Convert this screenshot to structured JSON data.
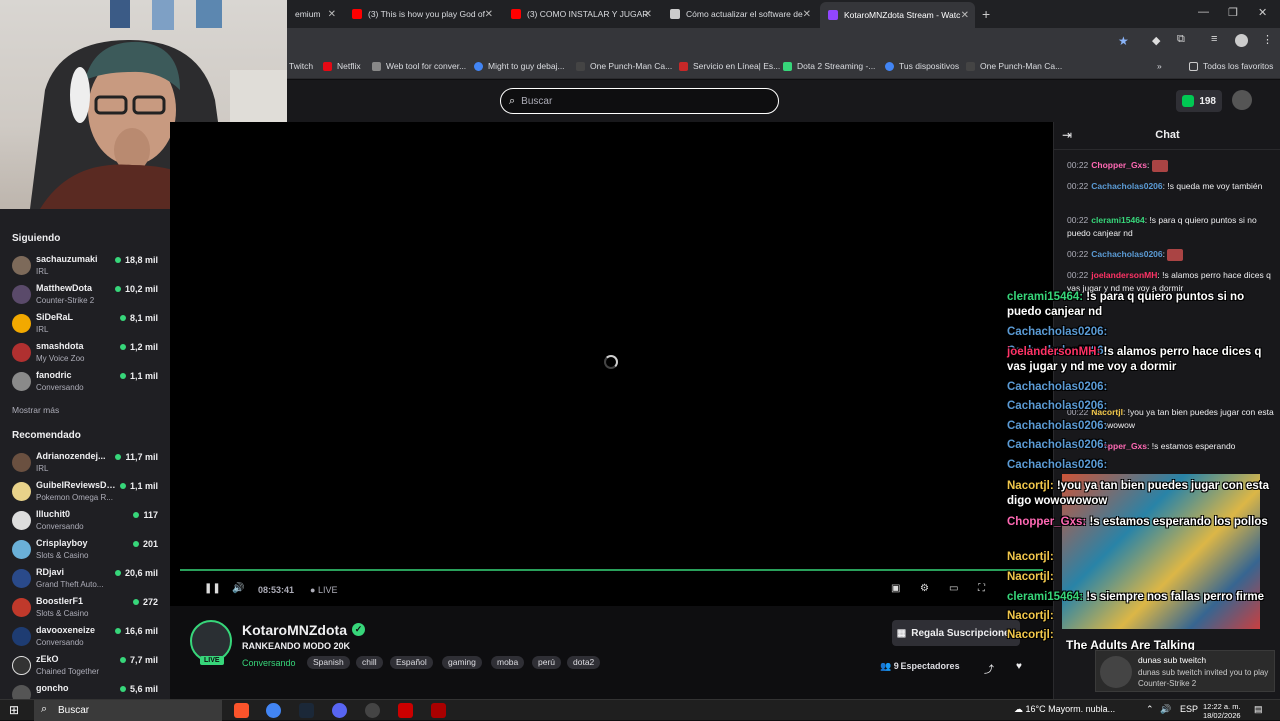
{
  "browser": {
    "tabs": [
      {
        "title": "emium",
        "color": "#ffffff"
      },
      {
        "title": "(3) This is how you play God of",
        "color": "#ff0000"
      },
      {
        "title": "(3) COMO INSTALAR Y JUGAR",
        "color": "#ff0000"
      },
      {
        "title": "Cómo actualizar el software de",
        "color": "#cccccc"
      },
      {
        "title": "KotaroMNZdota Stream - Watc",
        "color": "#9146ff"
      }
    ],
    "bookmarks": [
      "Twitch",
      "Netflix",
      "Web tool for conver...",
      "Might to guy debaj...",
      "One Punch-Man Ca...",
      "Servicio en Línea| Es...",
      "Dota 2 Streaming -...",
      "Tus dispositivos",
      "One Punch-Man Ca..."
    ],
    "all_favorites": "Todos los favoritos"
  },
  "topnav": {
    "search_placeholder": "Buscar",
    "points": "198"
  },
  "sidebar": {
    "following_title": "Siguiendo",
    "following": [
      {
        "name": "sachauzumaki",
        "game": "IRL",
        "viewers": "18,8 mil"
      },
      {
        "name": "MatthewDota",
        "game": "Counter-Strike 2",
        "viewers": "10,2 mil"
      },
      {
        "name": "SiDeRaL",
        "game": "IRL",
        "viewers": "8,1 mil"
      },
      {
        "name": "smashdota",
        "game": "My Voice Zoo",
        "viewers": "1,2 mil"
      },
      {
        "name": "fanodric",
        "game": "Conversando",
        "viewers": "1,1 mil"
      }
    ],
    "show_more": "Mostrar más",
    "recommended_title": "Recomendado",
    "recommended": [
      {
        "name": "Adrianozendej...",
        "game": "IRL",
        "viewers": "11,7 mil"
      },
      {
        "name": "GuibelReviewsDi...",
        "game": "Pokemon Omega R...",
        "viewers": "1,1 mil"
      },
      {
        "name": "Illuchit0",
        "game": "Conversando",
        "viewers": "117"
      },
      {
        "name": "Crisplayboy",
        "game": "Slots & Casino",
        "viewers": "201"
      },
      {
        "name": "RDjavi",
        "game": "Grand Theft Auto...",
        "viewers": "20,6 mil"
      },
      {
        "name": "BoostlerF1",
        "game": "Slots & Casino",
        "viewers": "272"
      },
      {
        "name": "davooxeneize",
        "game": "Conversando",
        "viewers": "16,6 mil"
      },
      {
        "name": "zEkO",
        "game": "Chained Together",
        "viewers": "7,7 mil"
      },
      {
        "name": "goncho",
        "game": "",
        "viewers": "5,6 mil"
      }
    ]
  },
  "player": {
    "time": "08:53:41",
    "live": "LIVE"
  },
  "stream": {
    "streamer": "KotaroMNZdota",
    "live_badge": "LIVE",
    "title": "RANKEANDO MODO 20K",
    "category": "Conversando",
    "tags": [
      "Spanish",
      "chill",
      "Español",
      "gaming",
      "moba",
      "perú",
      "dota2"
    ],
    "subscribe_label": "Regala Suscripciones",
    "viewers_label": "9 Espectadores"
  },
  "chat": {
    "title": "Chat",
    "messages": [
      {
        "time": "00:22",
        "user": "Chopper_Gxs",
        "color": "#ff69b4",
        "text": ""
      },
      {
        "time": "00:22",
        "user": "Cachacholas0206",
        "color": "#5b9bd5",
        "text": "!s queda me voy también"
      },
      {
        "time": "00:22",
        "user": "clerami15464",
        "color": "#37d67a",
        "text": "!s para q quiero puntos si no puedo canjear nd"
      },
      {
        "time": "00:22",
        "user": "Cachacholas0206",
        "color": "#5b9bd5",
        "text": ""
      },
      {
        "time": "00:22",
        "user": "joelandersonMH",
        "color": "#ff3366",
        "text": "!s alamos perro hace dices q vas jugar y nd me voy a dormir"
      },
      {
        "time": "00:22",
        "user": "Nacortjl",
        "color": "#f2c84b",
        "text": "!you ya tan bien puedes jugar con esta digo wowowowow"
      },
      {
        "time": "00:22",
        "user": "Chopper_Gxs",
        "color": "#ff69b4",
        "text": "!s estamos esperando"
      }
    ]
  },
  "overlay": {
    "lines": [
      {
        "user": "clerami15464:",
        "color": "#37d67a",
        "text": " !s para q quiero puntos si no puedo canjear nd"
      },
      {
        "user": "Cachacholas0206:",
        "color": "#5b9bd5",
        "text": ""
      },
      {
        "user": "Cachacholas0206:",
        "color": "#5b9bd5",
        "text": ""
      },
      {
        "user": "joelandersonMH:",
        "color": "#ff3366",
        "text": " !s alamos perro hace dices q vas jugar y nd me voy a dormir"
      },
      {
        "user": "Cachacholas0206:",
        "color": "#5b9bd5",
        "text": ""
      },
      {
        "user": "Cachacholas0206:",
        "color": "#5b9bd5",
        "text": ""
      },
      {
        "user": "Cachacholas0206:",
        "color": "#5b9bd5",
        "text": ""
      },
      {
        "user": "Cachacholas0206:",
        "color": "#5b9bd5",
        "text": ""
      },
      {
        "user": "Cachacholas0206:",
        "color": "#5b9bd5",
        "text": ""
      },
      {
        "user": "Nacortjl:",
        "color": "#f2c84b",
        "text": " !you ya tan bien puedes jugar con esta digo wowowowow"
      },
      {
        "user": "Chopper_Gxs:",
        "color": "#ff69b4",
        "text": " !s estamos esperando los pollos"
      },
      {
        "user": "Nacortjl:",
        "color": "#f2c84b",
        "text": ""
      },
      {
        "user": "Nacortjl:",
        "color": "#f2c84b",
        "text": ""
      },
      {
        "user": "clerami15464:",
        "color": "#37d67a",
        "text": " !s siempre nos fallas perro firme"
      },
      {
        "user": "Nacortjl:",
        "color": "#f2c84b",
        "text": ""
      },
      {
        "user": "Nacortjl:",
        "color": "#f2c84b",
        "text": ""
      }
    ],
    "adults": "The Adults Are Talking"
  },
  "notification": {
    "title": "dunas sub tweitch",
    "body": "dunas sub tweitch invited you to play Counter-Strike 2"
  },
  "taskbar": {
    "search": "Buscar",
    "weather": "16°C  Mayorm. nubla...",
    "lang": "ESP",
    "time": "12:22 a. m.",
    "date": "18/02/2026"
  }
}
